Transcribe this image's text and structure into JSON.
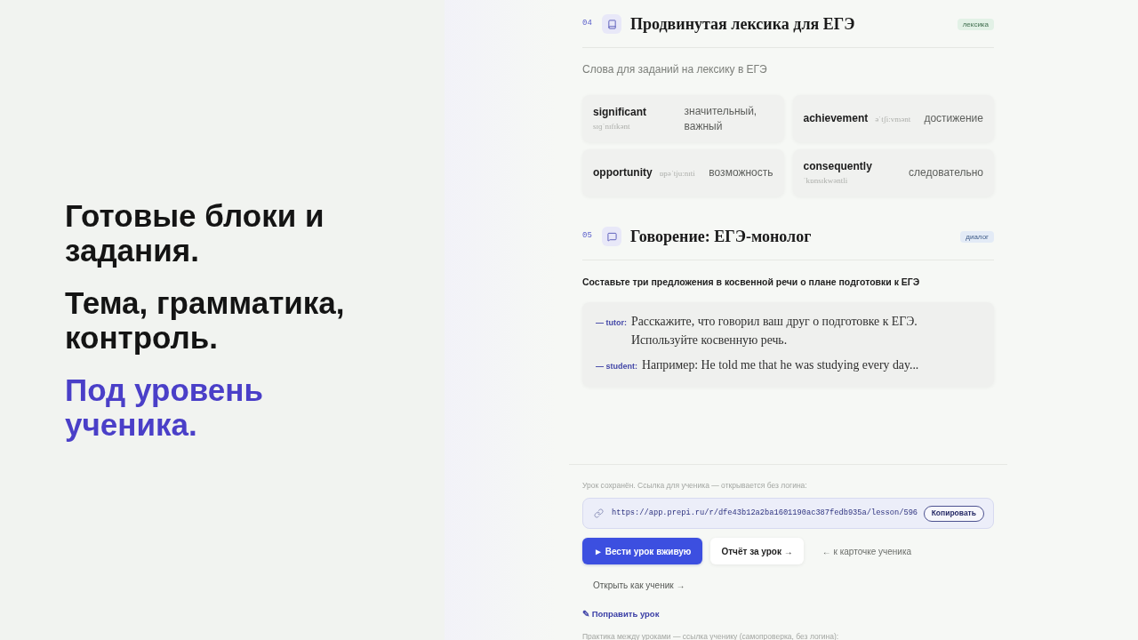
{
  "hero": {
    "lines": [
      {
        "text": "Готовые блоки и задания.",
        "accent": false
      },
      {
        "text": "Тема, грамматика, контроль.",
        "accent": false
      },
      {
        "text": "Под уровень ученика.",
        "accent": true
      }
    ]
  },
  "lesson_blocks": [
    {
      "number": "04",
      "kind": "vocabulary",
      "title": "Продвинутая лексика для ЕГЭ",
      "tag": "лексика",
      "subtitle": "Слова для заданий на лексику в ЕГЭ",
      "words": [
        {
          "word": "significant",
          "transcription": "sɪɡˈnɪfɪkənt",
          "translation": "значительный, важный"
        },
        {
          "word": "achievement",
          "transcription": "əˈtʃiːvmənt",
          "translation": "достижение"
        },
        {
          "word": "opportunity",
          "transcription": "ɒpəˈtjuːnɪti",
          "translation": "возможность"
        },
        {
          "word": "consequently",
          "transcription": "ˈkɒnsɪkwəntli",
          "translation": "следовательно"
        }
      ]
    },
    {
      "number": "05",
      "kind": "dialogue",
      "title": "Говорение: ЕГЭ-монолог",
      "tag": "диалог",
      "instruction": "Составьте три предложения в косвенной речи о плане подготовки к ЕГЭ",
      "lines": [
        {
          "speaker": "— tutor:",
          "text": "Расскажите, что говорил ваш друг о подготовке к ЕГЭ. Используйте косвенную речь."
        },
        {
          "speaker": "— student:",
          "text": "Например: He told me that he was studying every day..."
        }
      ]
    }
  ],
  "saved": {
    "note": "Урок сохранён. Ссылка для ученика — открывается без логина:",
    "url": "https://app.prepi.ru/r/dfe43b12a2ba1601190ac387fedb935a/lesson/596",
    "copy_button": "Копировать"
  },
  "actions": [
    {
      "label": "► Вести урок вживую",
      "kind": "primary"
    },
    {
      "label": "Отчёт за урок →",
      "kind": "secondary"
    },
    {
      "label": "← к карточке ученика",
      "kind": "link"
    },
    {
      "label": "Открыть как ученик →",
      "kind": "ghost"
    }
  ],
  "edit_link": "✎ Поправить урок",
  "practice_note": "Практика между уроками — ссылка ученику (самопроверка, без логина):"
}
